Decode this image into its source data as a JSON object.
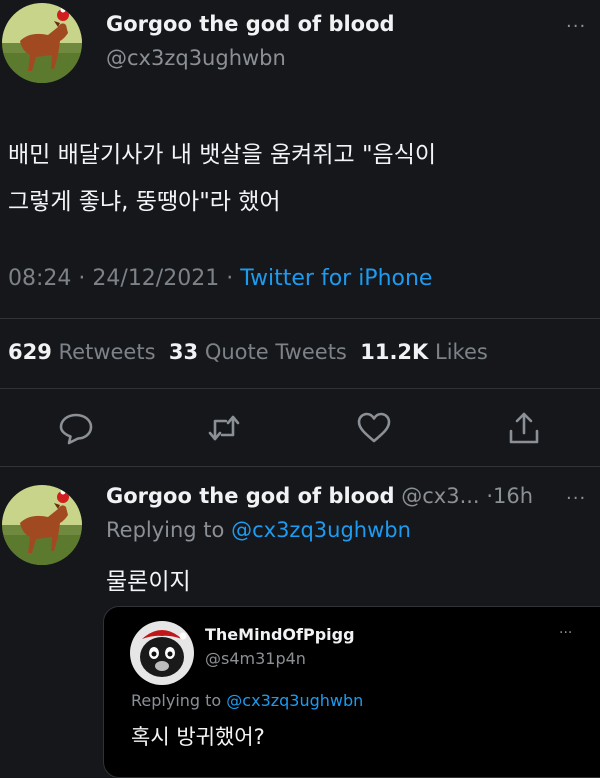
{
  "main_tweet": {
    "author_name": "Gorgoo the god of blood",
    "handle": "@cx3zq3ughwbn",
    "more_icon": "more-icon",
    "text_line1": "배민 배달기사가 내 뱃살을 움켜쥐고 \"음식이",
    "text_line2": "그렇게 좋냐, 뚱땡아\"라 했어",
    "time": "08:24",
    "date": "24/12/2021",
    "source": "Twitter for iPhone",
    "separator": "·",
    "stats": {
      "retweets_count": "629",
      "retweets_label": "Retweets",
      "quotes_count": "33",
      "quotes_label": "Quote Tweets",
      "likes_count": "11.2K",
      "likes_label": "Likes"
    },
    "actions": [
      "reply-icon",
      "retweet-icon",
      "like-icon",
      "share-icon"
    ]
  },
  "reply_tweet": {
    "author_name": "Gorgoo the god of blood",
    "handle_truncated": "@cx3...",
    "time_ago": "16h",
    "replying_prefix": "Replying to",
    "replying_to": "@cx3zq3ughwbn",
    "text": "물론이지"
  },
  "quoted_tweet": {
    "author_name": "TheMindOfPpigg",
    "handle": "@s4m31p4n",
    "replying_prefix": "Replying to",
    "replying_to": "@cx3zq3ughwbn",
    "text": "혹시 방귀했어?"
  },
  "colors": {
    "background": "#15171a",
    "link": "#1d9bf0",
    "muted": "#8b9096",
    "text": "#f3f4f5",
    "divider": "#2f3336"
  }
}
